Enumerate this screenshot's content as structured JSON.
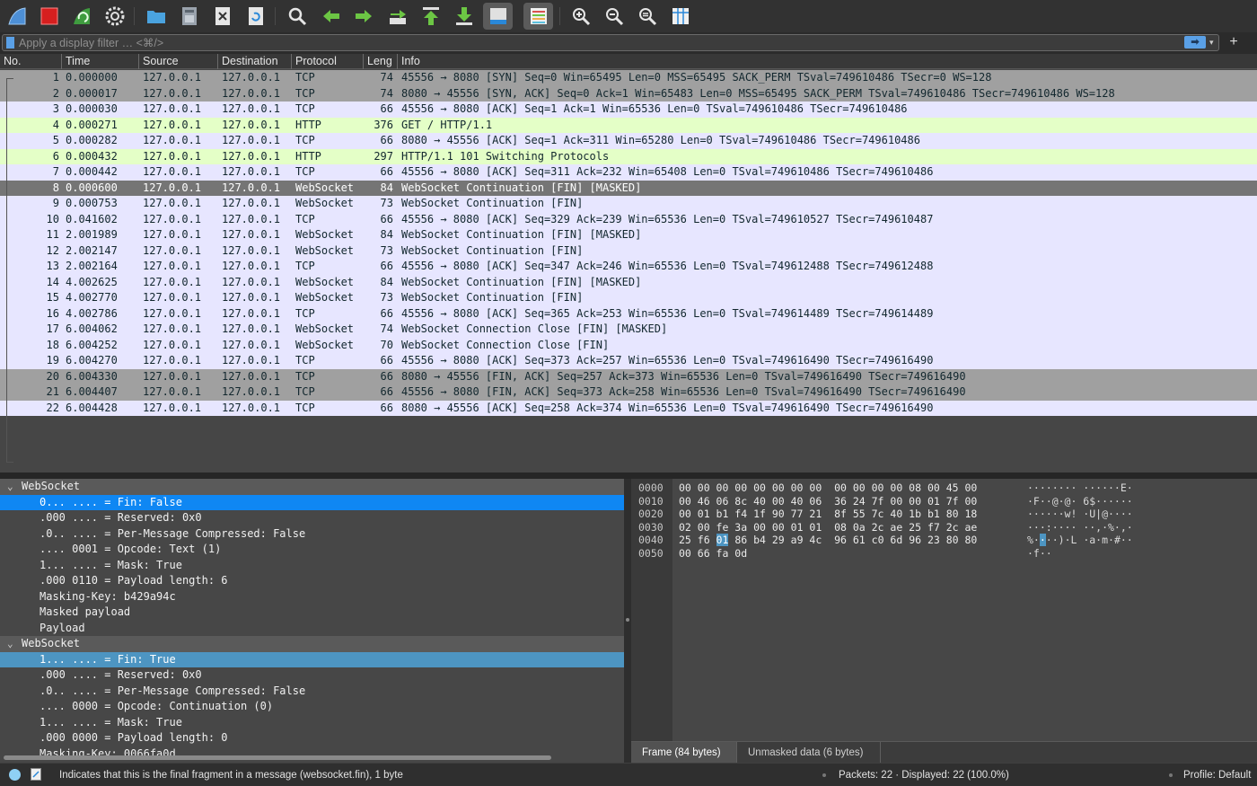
{
  "toolbar": {
    "buttons": [
      "start-capture",
      "stop-capture",
      "restart-capture",
      "capture-options",
      "open-file",
      "save-file",
      "close-file",
      "reload-file",
      "find-packet",
      "go-back",
      "go-forward",
      "go-to-packet",
      "go-first",
      "go-last",
      "auto-scroll",
      "colorize",
      "zoom-in",
      "zoom-out",
      "zoom-reset",
      "resize-columns"
    ]
  },
  "filter": {
    "placeholder": "Apply a display filter … <⌘/>",
    "apply_label": "➡",
    "dropdown_label": "▾",
    "add_label": "+"
  },
  "packet_list": {
    "columns": [
      "No.",
      "Time",
      "Source",
      "Destination",
      "Protocol",
      "Leng",
      "Info"
    ],
    "rows": [
      {
        "no": "1",
        "time": "0.000000",
        "src": "127.0.0.1",
        "dst": "127.0.0.1",
        "proto": "TCP",
        "len": "74",
        "info": "45556 → 8080 [SYN] Seq=0 Win=65495 Len=0 MSS=65495 SACK_PERM TSval=749610486 TSecr=0 WS=128",
        "style": "gray"
      },
      {
        "no": "2",
        "time": "0.000017",
        "src": "127.0.0.1",
        "dst": "127.0.0.1",
        "proto": "TCP",
        "len": "74",
        "info": "8080 → 45556 [SYN, ACK] Seq=0 Ack=1 Win=65483 Len=0 MSS=65495 SACK_PERM TSval=749610486 TSecr=749610486 WS=128",
        "style": "gray"
      },
      {
        "no": "3",
        "time": "0.000030",
        "src": "127.0.0.1",
        "dst": "127.0.0.1",
        "proto": "TCP",
        "len": "66",
        "info": "45556 → 8080 [ACK] Seq=1 Ack=1 Win=65536 Len=0 TSval=749610486 TSecr=749610486",
        "style": "tcp"
      },
      {
        "no": "4",
        "time": "0.000271",
        "src": "127.0.0.1",
        "dst": "127.0.0.1",
        "proto": "HTTP",
        "len": "376",
        "info": "GET / HTTP/1.1",
        "style": "http"
      },
      {
        "no": "5",
        "time": "0.000282",
        "src": "127.0.0.1",
        "dst": "127.0.0.1",
        "proto": "TCP",
        "len": "66",
        "info": "8080 → 45556 [ACK] Seq=1 Ack=311 Win=65280 Len=0 TSval=749610486 TSecr=749610486",
        "style": "tcp"
      },
      {
        "no": "6",
        "time": "0.000432",
        "src": "127.0.0.1",
        "dst": "127.0.0.1",
        "proto": "HTTP",
        "len": "297",
        "info": "HTTP/1.1 101 Switching Protocols",
        "style": "http"
      },
      {
        "no": "7",
        "time": "0.000442",
        "src": "127.0.0.1",
        "dst": "127.0.0.1",
        "proto": "TCP",
        "len": "66",
        "info": "45556 → 8080 [ACK] Seq=311 Ack=232 Win=65408 Len=0 TSval=749610486 TSecr=749610486",
        "style": "tcp"
      },
      {
        "no": "8",
        "time": "0.000600",
        "src": "127.0.0.1",
        "dst": "127.0.0.1",
        "proto": "WebSocket",
        "len": "84",
        "info": "WebSocket Continuation [FIN] [MASKED]",
        "style": "selected"
      },
      {
        "no": "9",
        "time": "0.000753",
        "src": "127.0.0.1",
        "dst": "127.0.0.1",
        "proto": "WebSocket",
        "len": "73",
        "info": "WebSocket Continuation [FIN]",
        "style": "ws"
      },
      {
        "no": "10",
        "time": "0.041602",
        "src": "127.0.0.1",
        "dst": "127.0.0.1",
        "proto": "TCP",
        "len": "66",
        "info": "45556 → 8080 [ACK] Seq=329 Ack=239 Win=65536 Len=0 TSval=749610527 TSecr=749610487",
        "style": "tcp"
      },
      {
        "no": "11",
        "time": "2.001989",
        "src": "127.0.0.1",
        "dst": "127.0.0.1",
        "proto": "WebSocket",
        "len": "84",
        "info": "WebSocket Continuation [FIN] [MASKED]",
        "style": "ws"
      },
      {
        "no": "12",
        "time": "2.002147",
        "src": "127.0.0.1",
        "dst": "127.0.0.1",
        "proto": "WebSocket",
        "len": "73",
        "info": "WebSocket Continuation [FIN]",
        "style": "ws"
      },
      {
        "no": "13",
        "time": "2.002164",
        "src": "127.0.0.1",
        "dst": "127.0.0.1",
        "proto": "TCP",
        "len": "66",
        "info": "45556 → 8080 [ACK] Seq=347 Ack=246 Win=65536 Len=0 TSval=749612488 TSecr=749612488",
        "style": "tcp"
      },
      {
        "no": "14",
        "time": "4.002625",
        "src": "127.0.0.1",
        "dst": "127.0.0.1",
        "proto": "WebSocket",
        "len": "84",
        "info": "WebSocket Continuation [FIN] [MASKED]",
        "style": "ws"
      },
      {
        "no": "15",
        "time": "4.002770",
        "src": "127.0.0.1",
        "dst": "127.0.0.1",
        "proto": "WebSocket",
        "len": "73",
        "info": "WebSocket Continuation [FIN]",
        "style": "ws"
      },
      {
        "no": "16",
        "time": "4.002786",
        "src": "127.0.0.1",
        "dst": "127.0.0.1",
        "proto": "TCP",
        "len": "66",
        "info": "45556 → 8080 [ACK] Seq=365 Ack=253 Win=65536 Len=0 TSval=749614489 TSecr=749614489",
        "style": "tcp"
      },
      {
        "no": "17",
        "time": "6.004062",
        "src": "127.0.0.1",
        "dst": "127.0.0.1",
        "proto": "WebSocket",
        "len": "74",
        "info": "WebSocket Connection Close [FIN] [MASKED]",
        "style": "ws"
      },
      {
        "no": "18",
        "time": "6.004252",
        "src": "127.0.0.1",
        "dst": "127.0.0.1",
        "proto": "WebSocket",
        "len": "70",
        "info": "WebSocket Connection Close [FIN]",
        "style": "ws"
      },
      {
        "no": "19",
        "time": "6.004270",
        "src": "127.0.0.1",
        "dst": "127.0.0.1",
        "proto": "TCP",
        "len": "66",
        "info": "45556 → 8080 [ACK] Seq=373 Ack=257 Win=65536 Len=0 TSval=749616490 TSecr=749616490",
        "style": "tcp"
      },
      {
        "no": "20",
        "time": "6.004330",
        "src": "127.0.0.1",
        "dst": "127.0.0.1",
        "proto": "TCP",
        "len": "66",
        "info": "8080 → 45556 [FIN, ACK] Seq=257 Ack=373 Win=65536 Len=0 TSval=749616490 TSecr=749616490",
        "style": "gray"
      },
      {
        "no": "21",
        "time": "6.004407",
        "src": "127.0.0.1",
        "dst": "127.0.0.1",
        "proto": "TCP",
        "len": "66",
        "info": "45556 → 8080 [FIN, ACK] Seq=373 Ack=258 Win=65536 Len=0 TSval=749616490 TSecr=749616490",
        "style": "gray"
      },
      {
        "no": "22",
        "time": "6.004428",
        "src": "127.0.0.1",
        "dst": "127.0.0.1",
        "proto": "TCP",
        "len": "66",
        "info": "8080 → 45556 [ACK] Seq=258 Ack=374 Win=65536 Len=0 TSval=749616490 TSecr=749616490",
        "style": "tcp"
      }
    ]
  },
  "details": {
    "rows": [
      {
        "text": "WebSocket",
        "kind": "section",
        "chevron": "⌄"
      },
      {
        "text": "0... .... = Fin: False",
        "kind": "sel1"
      },
      {
        "text": ".000 .... = Reserved: 0x0",
        "kind": "field"
      },
      {
        "text": ".0.. .... = Per-Message Compressed: False",
        "kind": "field"
      },
      {
        "text": ".... 0001 = Opcode: Text (1)",
        "kind": "field"
      },
      {
        "text": "1... .... = Mask: True",
        "kind": "field"
      },
      {
        "text": ".000 0110 = Payload length: 6",
        "kind": "field"
      },
      {
        "text": "Masking-Key: b429a94c",
        "kind": "field"
      },
      {
        "text": "Masked payload",
        "kind": "field"
      },
      {
        "text": "Payload",
        "kind": "field"
      },
      {
        "text": "WebSocket",
        "kind": "section",
        "chevron": "⌄"
      },
      {
        "text": "1... .... = Fin: True",
        "kind": "sel2"
      },
      {
        "text": ".000 .... = Reserved: 0x0",
        "kind": "field"
      },
      {
        "text": ".0.. .... = Per-Message Compressed: False",
        "kind": "field"
      },
      {
        "text": ".... 0000 = Opcode: Continuation (0)",
        "kind": "field"
      },
      {
        "text": "1... .... = Mask: True",
        "kind": "field"
      },
      {
        "text": ".000 0000 = Payload length: 0",
        "kind": "field"
      },
      {
        "text": "Masking-Key: 0066fa0d",
        "kind": "field"
      }
    ]
  },
  "bytes": {
    "rows": [
      {
        "offset": "0000",
        "hex": "00 00 00 00 00 00 00 00  00 00 00 00 08 00 45 00",
        "ascii": "········ ······E·"
      },
      {
        "offset": "0010",
        "hex": "00 46 06 8c 40 00 40 06  36 24 7f 00 00 01 7f 00",
        "ascii": "·F··@·@· 6$······"
      },
      {
        "offset": "0020",
        "hex": "00 01 b1 f4 1f 90 77 21  8f 55 7c 40 1b b1 80 18",
        "ascii": "······w! ·U|@····"
      },
      {
        "offset": "0030",
        "hex": "02 00 fe 3a 00 00 01 01  08 0a 2c ae 25 f7 2c ae",
        "ascii": "···:···· ··,·%·,·"
      },
      {
        "offset": "0040",
        "hex_pre": "25 f6 ",
        "hex_hl": "01",
        "hex_post": " 86 b4 29 a9 4c  96 61 c0 6d 96 23 80 80",
        "ascii_pre": "%·",
        "ascii_hl": "·",
        "ascii_post": "··)·L ·a·m·#··"
      },
      {
        "offset": "0050",
        "hex": "00 66 fa 0d",
        "ascii": "·f··"
      }
    ],
    "tabs": [
      "Frame (84 bytes)",
      "Unmasked data (6 bytes)"
    ]
  },
  "status": {
    "message": "Indicates that this is the final fragment in a message (websocket.fin), 1 byte",
    "packets": "Packets: 22 · Displayed: 22 (100.0%)",
    "profile": "Profile: Default"
  },
  "colors": {
    "tcp_row": "#e7e6ff",
    "http_row": "#e4ffc7",
    "gray_row": "#a0a0a0",
    "selected_row": "#757575",
    "detail_selected": "#0f87f3"
  }
}
